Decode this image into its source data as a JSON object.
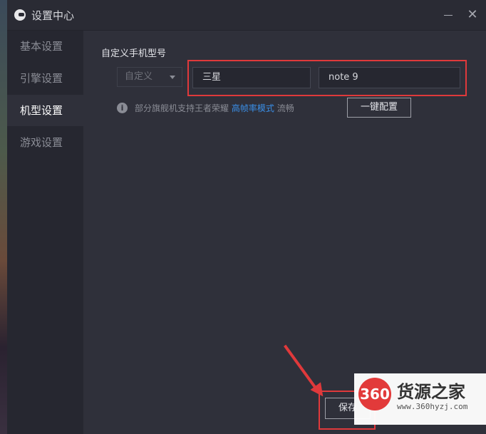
{
  "window": {
    "title": "设置中心",
    "minimize_symbol": "",
    "close_symbol": "✕"
  },
  "sidebar": {
    "items": [
      {
        "label": "基本设置",
        "active": false
      },
      {
        "label": "引擎设置",
        "active": false
      },
      {
        "label": "机型设置",
        "active": true
      },
      {
        "label": "游戏设置",
        "active": false
      }
    ]
  },
  "main": {
    "section_title": "自定义手机型号",
    "device_type": {
      "selected": "自定义"
    },
    "brand_input": {
      "value": "三星"
    },
    "model_input": {
      "value": "note 9"
    },
    "hint": {
      "icon": "info-icon",
      "icon_glyph": "i",
      "prefix": "部分旗舰机支持王者荣耀",
      "link": "高帧率模式",
      "suffix": "流畅"
    },
    "one_key_button": "一键配置",
    "save_button": "保存"
  },
  "annotation": {
    "highlight_color": "#e0393b"
  },
  "watermark": {
    "logo_text": "360",
    "title": "货源之家",
    "url": "www.360hyzj.com"
  },
  "colors": {
    "background": "#2f303a",
    "sidebar": "#262730",
    "link": "#3a8ee6",
    "accent_red": "#e0393b"
  }
}
